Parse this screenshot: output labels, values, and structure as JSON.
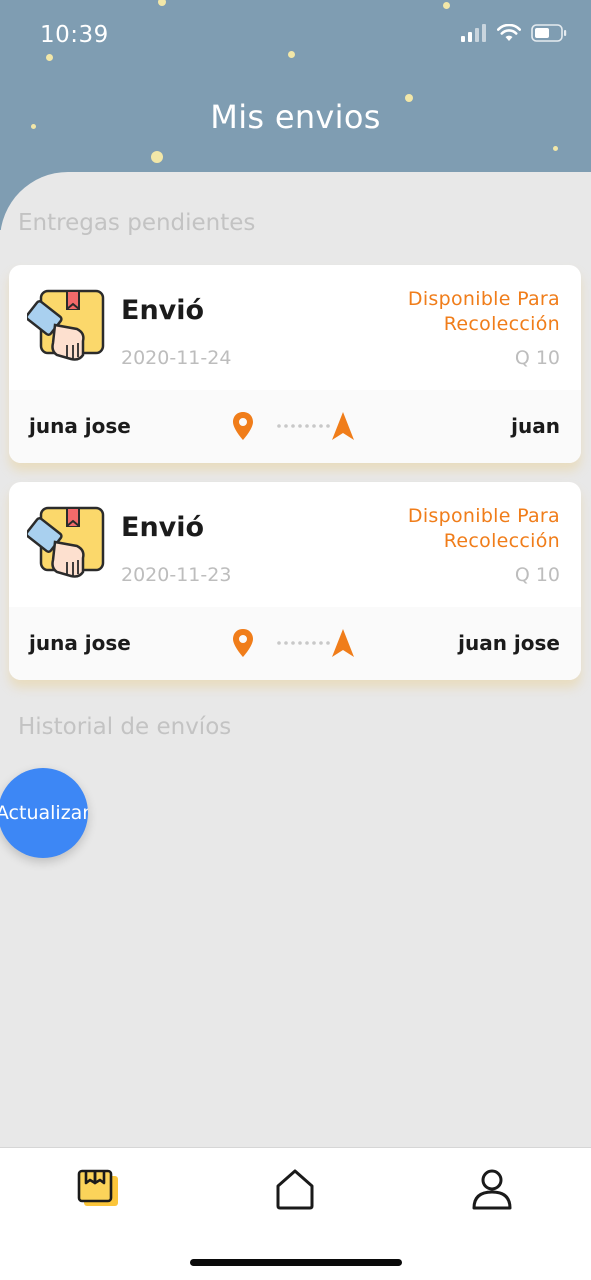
{
  "status_bar": {
    "time": "10:39"
  },
  "header": {
    "title": "Mis envios"
  },
  "sections": {
    "pending_title": "Entregas pendientes",
    "history_title": "Historial de envíos"
  },
  "shipments": [
    {
      "type": "Envió",
      "date": "2020-11-24",
      "status": "Disponible Para Recolección",
      "price": "Q 10",
      "from": "juna jose",
      "to": "juan"
    },
    {
      "type": "Envió",
      "date": "2020-11-23",
      "status": "Disponible Para Recolección",
      "price": "Q 10",
      "from": "juna jose",
      "to": "juan jose"
    }
  ],
  "fab": {
    "label": "Actualizar"
  },
  "tabs": [
    {
      "icon": "package-icon",
      "active": true
    },
    {
      "icon": "home-icon",
      "active": false
    },
    {
      "icon": "user-icon",
      "active": false
    }
  ],
  "colors": {
    "header_bg": "#7f9db2",
    "accent_orange": "#f07d1a",
    "fab_blue": "#3d87f5",
    "page_bg": "#e8e8e8"
  }
}
